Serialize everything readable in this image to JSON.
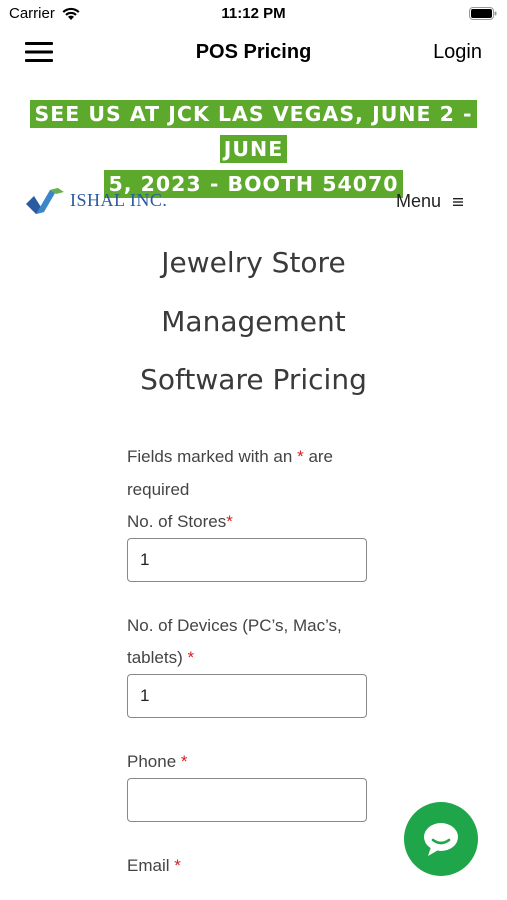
{
  "status_bar": {
    "carrier": "Carrier",
    "time": "11:12 PM"
  },
  "nav": {
    "title": "POS Pricing",
    "login": "Login"
  },
  "promo": {
    "line1": "SEE US AT JCK LAS VEGAS, JUNE 2 - JUNE",
    "line2": "5, 2023 - BOOTH 54070",
    "background_color": "#5da92c"
  },
  "site_header": {
    "logo_text": "ISHAL INC.",
    "menu_label": "Menu"
  },
  "page": {
    "title_lines": [
      "Jewelry Store",
      "Management",
      "Software Pricing"
    ]
  },
  "form": {
    "required_note_prefix": "Fields marked with an",
    "required_star": "*",
    "required_note_suffix": "are required",
    "stores_label": "No. of Stores",
    "stores_value": "1",
    "devices_label": "No. of Devices (PC’s, Mac’s, tablets)",
    "devices_value": "1",
    "phone_label": "Phone",
    "phone_value": "",
    "email_label": "Email"
  },
  "chat": {
    "icon": "chat-bubble-icon",
    "color": "#1fa64b"
  }
}
